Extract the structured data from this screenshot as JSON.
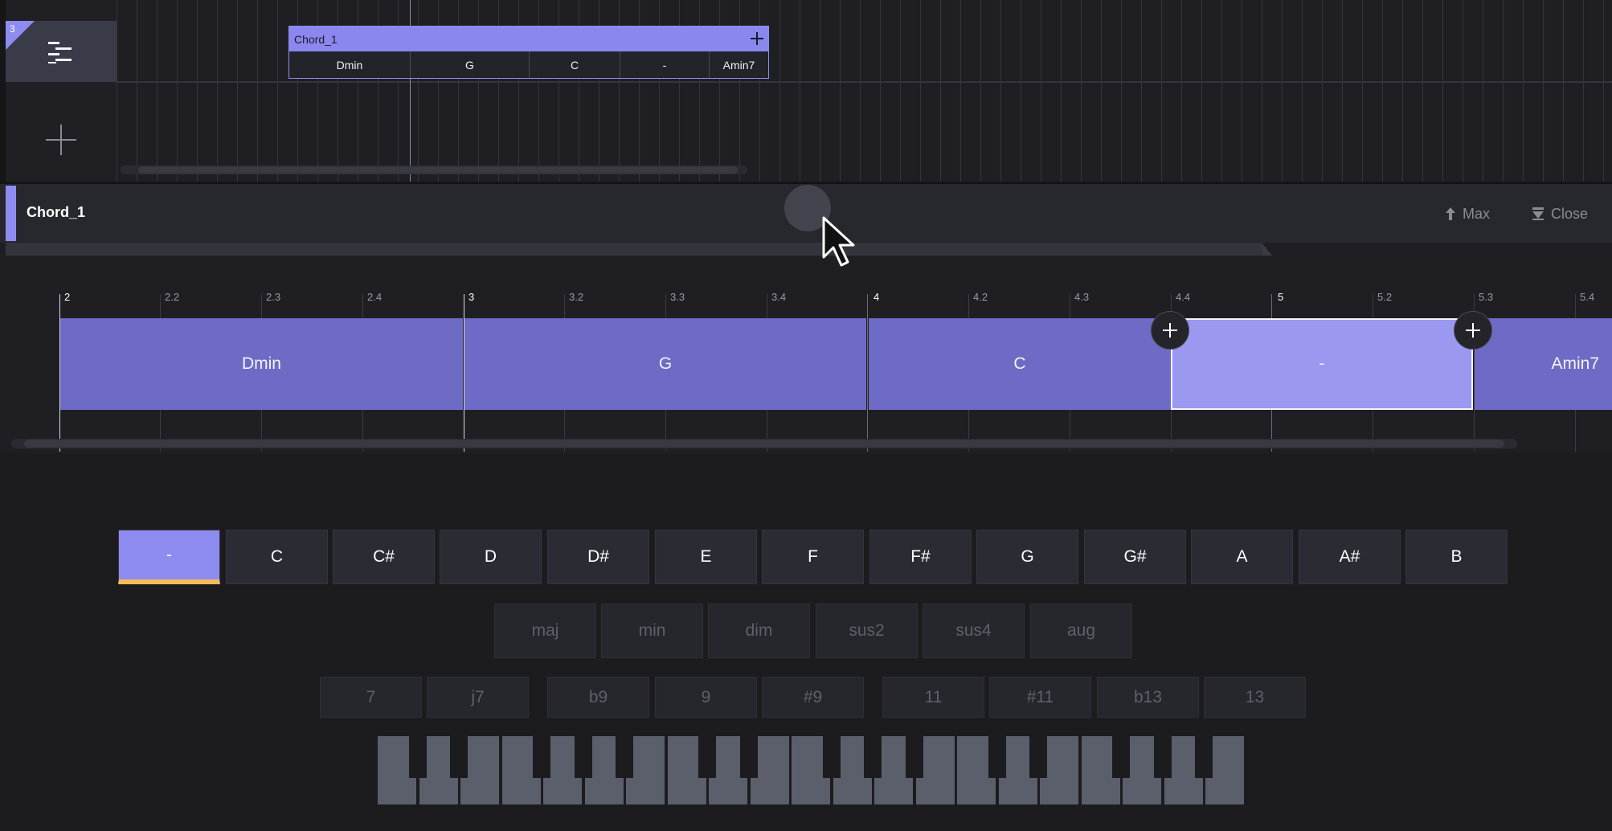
{
  "track": {
    "badge_number": "3",
    "icons": {
      "menu": "track-menu-icon",
      "add": "add-track-icon"
    }
  },
  "top_clip": {
    "title": "Chord_1",
    "cells": [
      "Dmin",
      "G",
      "C",
      "-",
      "Amin7"
    ]
  },
  "editor": {
    "title": "Chord_1",
    "max_label": "Max",
    "close_label": "Close",
    "ruler": {
      "labels": [
        "2",
        "2.2",
        "2.3",
        "2.4",
        "3",
        "3.2",
        "3.3",
        "3.4",
        "4",
        "4.2",
        "4.3",
        "4.4",
        "5",
        "5.2",
        "5.3",
        "5.4"
      ]
    },
    "chords": [
      "Dmin",
      "G",
      "C",
      "-",
      "Amin7"
    ],
    "selected_chord_index": 3
  },
  "keyboard_panel": {
    "roots": [
      "-",
      "C",
      "C#",
      "D",
      "D#",
      "E",
      "F",
      "F#",
      "G",
      "G#",
      "A",
      "A#",
      "B"
    ],
    "active_root": "-",
    "qualities": [
      "maj",
      "min",
      "dim",
      "sus2",
      "sus4",
      "aug"
    ],
    "extensions": [
      "7",
      "j7",
      "b9",
      "9",
      "#9",
      "11",
      "#11",
      "b13",
      "13"
    ]
  },
  "colors": {
    "accent": "#8e8cf0",
    "chord_block": "#6e6bc6",
    "selected_block": "#9b98f0",
    "active_underline": "#f5bd5a",
    "background": "#1c1c1f"
  }
}
